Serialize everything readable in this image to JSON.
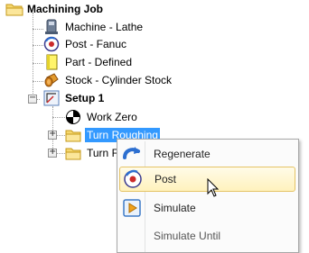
{
  "tree": {
    "root": {
      "label": "Machining Job",
      "icon": "folder-icon"
    },
    "children": [
      {
        "label": "Machine - Lathe",
        "icon": "lathe-machine-icon"
      },
      {
        "label": "Post - Fanuc",
        "icon": "post-processor-icon"
      },
      {
        "label": "Part - Defined",
        "icon": "part-page-icon"
      },
      {
        "label": "Stock - Cylinder Stock",
        "icon": "cylinder-stock-icon"
      }
    ],
    "setup": {
      "label": "Setup 1",
      "icon": "setup-icon",
      "expander": "−",
      "children": [
        {
          "label": "Work Zero",
          "icon": "work-zero-icon"
        },
        {
          "label": "Turn Roughing",
          "icon": "folder-icon",
          "expander": "+",
          "selected": true
        },
        {
          "label": "Turn F",
          "icon": "folder-icon",
          "expander": "+"
        }
      ]
    }
  },
  "context_menu": {
    "items": [
      {
        "label": "Regenerate",
        "icon": "regenerate-icon"
      },
      {
        "label": "Post",
        "icon": "post-icon",
        "hovered": true
      },
      {
        "label": "Simulate",
        "icon": "play-icon"
      },
      {
        "label": "Simulate Until",
        "icon": ""
      }
    ]
  },
  "colors": {
    "selection": "#3399ff",
    "menu_hover": "#fff2bd"
  }
}
